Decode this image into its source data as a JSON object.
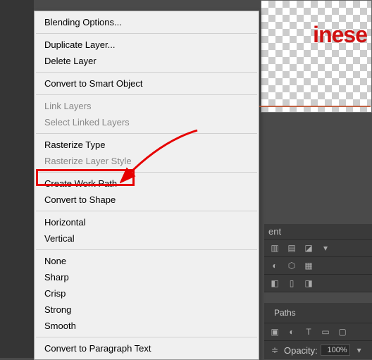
{
  "canvas": {
    "sample_text": "inese"
  },
  "menu": {
    "blending_options": "Blending Options...",
    "duplicate_layer": "Duplicate Layer...",
    "delete_layer": "Delete Layer",
    "convert_smart": "Convert to Smart Object",
    "link_layers": "Link Layers",
    "select_linked": "Select Linked Layers",
    "rasterize_type": "Rasterize Type",
    "rasterize_style": "Rasterize Layer Style",
    "create_work_path": "Create Work Path",
    "convert_shape": "Convert to Shape",
    "horizontal": "Horizontal",
    "vertical": "Vertical",
    "none": "None",
    "sharp": "Sharp",
    "crisp": "Crisp",
    "strong": "Strong",
    "smooth": "Smooth",
    "paragraph": "Convert to Paragraph Text"
  },
  "panels": {
    "adjustments_hint": "ent",
    "paths_tab": "Paths",
    "opacity_label": "Opacity:",
    "opacity_value": "100%"
  }
}
